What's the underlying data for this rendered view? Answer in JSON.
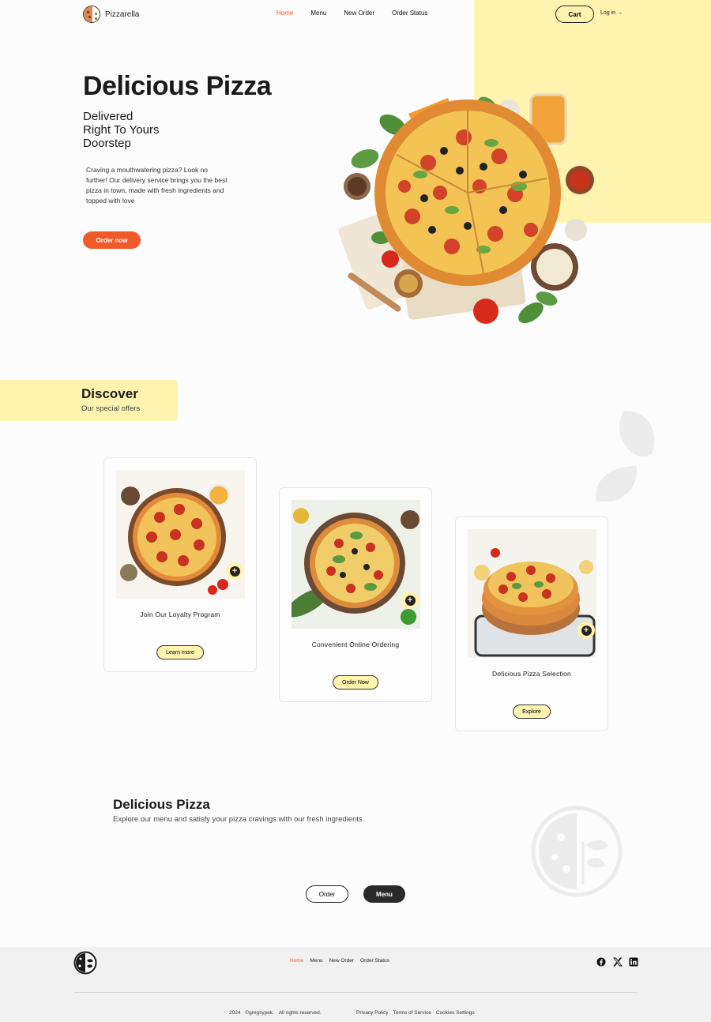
{
  "brand": {
    "name": "Pizzarella"
  },
  "nav": {
    "links": [
      "Home",
      "Menu",
      "New Order",
      "Order Status"
    ],
    "active": "Home",
    "cart_label": "Cart",
    "login_label": "Log in →"
  },
  "hero": {
    "title": "Delicious Pizza",
    "subtitle_lines": [
      "Delivered",
      "Right To Yours",
      "Doorstep"
    ],
    "description": "Craving a mouthwatering pizza? Look no further! Our delivery service brings you the best pizza in town, made with fresh ingredients and topped with love",
    "cta_label": "Order now",
    "image_icon": "pizza-image"
  },
  "discover": {
    "title": "Discover",
    "subtitle": "Our special offers"
  },
  "offers": [
    {
      "title": "Join Our Loyalty Program",
      "button": "Learn more",
      "icon": "plus-icon"
    },
    {
      "title": "Convenient Online Ordering",
      "button": "Order Now",
      "icon": "plus-icon"
    },
    {
      "title": "Delicious Pizza Selection",
      "button": "Explore",
      "icon": "plus-icon"
    }
  ],
  "menu_section": {
    "title": "Delicious Pizza",
    "subtitle": "Explore our menu and satisfy your pizza cravings with our fresh ingredients",
    "order_label": "Order",
    "menu_label": "Menu"
  },
  "footer": {
    "links": [
      "Home",
      "Menu",
      "New Order",
      "Order Status"
    ],
    "active": "Home",
    "social": [
      "facebook-icon",
      "x-icon",
      "linkedin-icon"
    ],
    "copyright_year": "2024",
    "copyright_owner": "©gregsypek.",
    "rights": "All rights reserved.",
    "legal": [
      "Privacy Policy",
      "Terms of Service",
      "Cookies Settings"
    ]
  },
  "colors": {
    "accent": "#f05a28",
    "highlight": "#fff3b0",
    "dark": "#2a2a2a",
    "footer_bg": "#f1f1f1"
  }
}
